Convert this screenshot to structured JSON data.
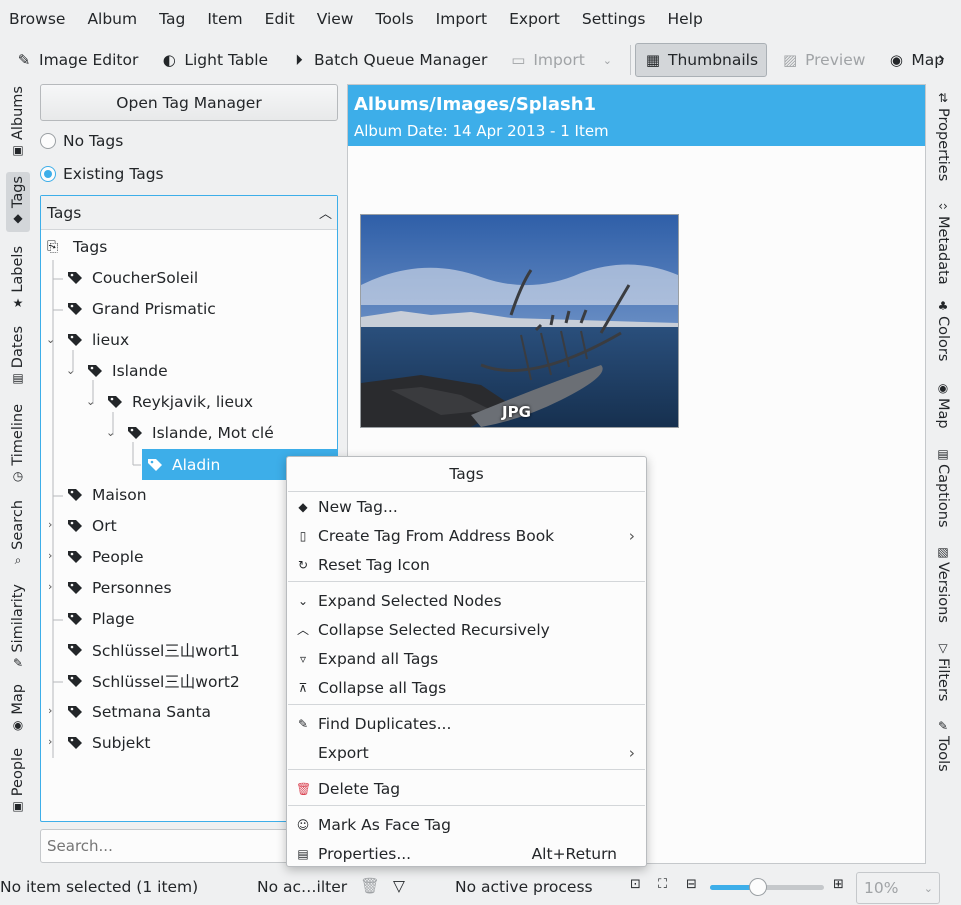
{
  "menu": [
    "Browse",
    "Album",
    "Tag",
    "Item",
    "Edit",
    "View",
    "Tools",
    "Import",
    "Export",
    "Settings",
    "Help"
  ],
  "toolbar": {
    "image_editor": "Image Editor",
    "light_table": "Light Table",
    "batch_queue": "Batch Queue Manager",
    "import": "Import",
    "thumbnails": "Thumbnails",
    "preview": "Preview",
    "map": "Map"
  },
  "left_tabs": {
    "albums": "Albums",
    "tags": "Tags",
    "labels": "Labels",
    "dates": "Dates",
    "timeline": "Timeline",
    "search": "Search",
    "similarity": "Similarity",
    "map": "Map",
    "people": "People"
  },
  "right_tabs": {
    "properties": "Properties",
    "metadata": "Metadata",
    "colors": "Colors",
    "map": "Map",
    "captions": "Captions",
    "versions": "Versions",
    "filters": "Filters",
    "tools": "Tools"
  },
  "sidebar": {
    "open_tag_manager": "Open Tag Manager",
    "no_tags": "No Tags",
    "existing_tags": "Existing Tags",
    "panel_title": "Tags",
    "search_placeholder": "Search...",
    "tree": [
      "Tags",
      "CoucherSoleil",
      "Grand Prismatic",
      "lieux",
      "Islande",
      "Reykjavik, lieux",
      "Islande, Mot clé",
      "Aladin",
      "Maison",
      "Ort",
      "People",
      "Personnes",
      "Plage",
      "Schlüssel三山wort1",
      "Schlüssel三山wort2",
      "Setmana Santa",
      "Subjekt"
    ]
  },
  "album": {
    "path": "Albums/Images/Splash1",
    "date": "Album Date: 14 Apr 2013 - 1 Item",
    "badge": "JPG"
  },
  "context_menu": {
    "title": "Tags",
    "items": [
      "New Tag...",
      "Create Tag From Address Book",
      "Reset Tag Icon",
      "Expand Selected Nodes",
      "Collapse Selected Recursively",
      "Expand all Tags",
      "Collapse all Tags",
      "Find Duplicates...",
      "Export",
      "Delete Tag",
      "Mark As Face Tag",
      "Properties..."
    ],
    "shortcut": "Alt+Return"
  },
  "status": {
    "selection": "No item selected (1 item)",
    "filter": "No ac…ilter",
    "process": "No active process",
    "zoom": "10%",
    "zoom_level": 0.42
  }
}
